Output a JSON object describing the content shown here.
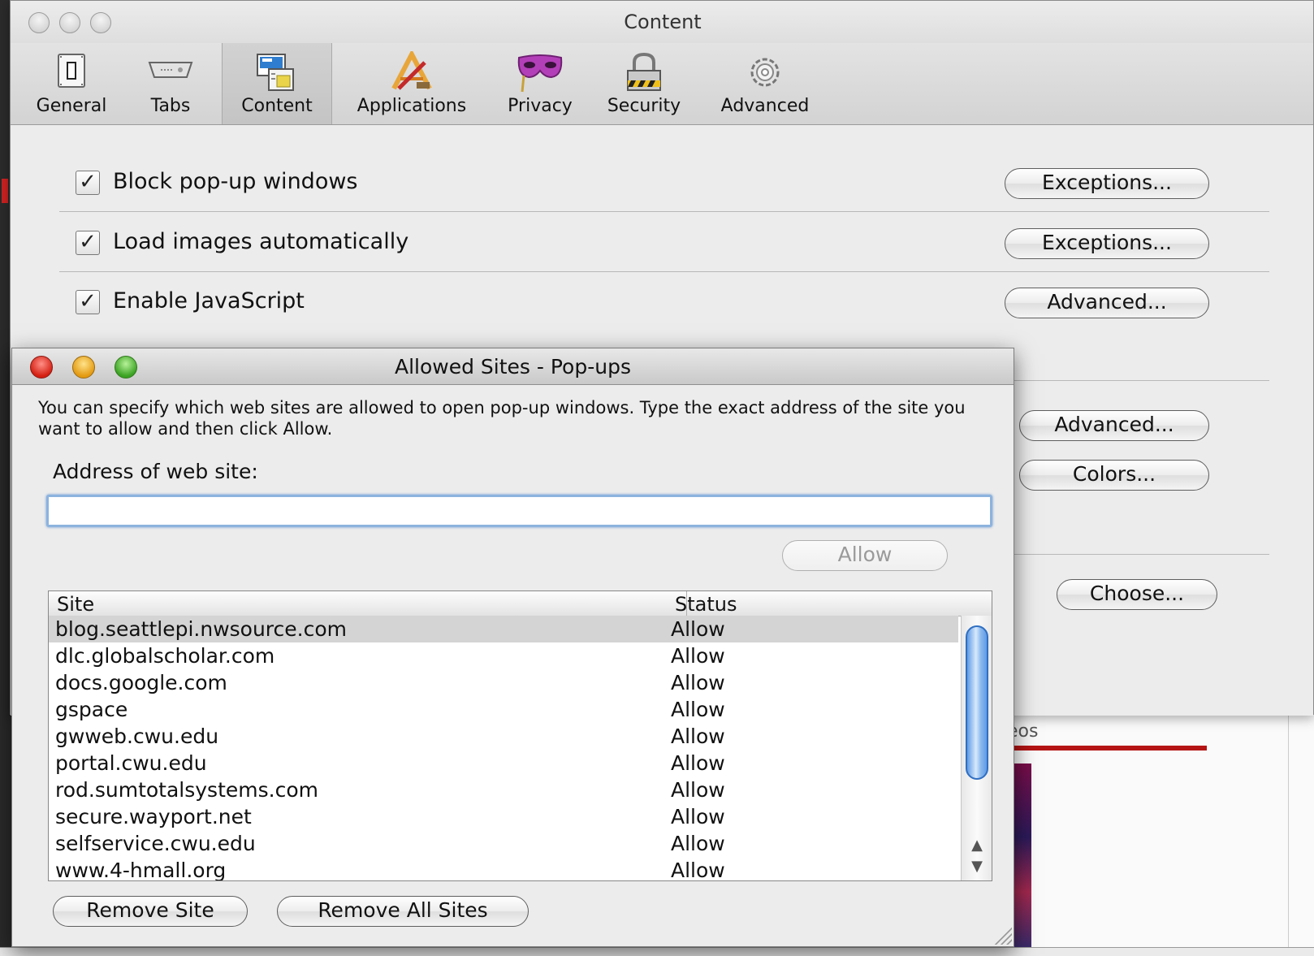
{
  "prefs": {
    "title": "Content",
    "toolbar": [
      {
        "label": "General",
        "icon": "general-switch-icon"
      },
      {
        "label": "Tabs",
        "icon": "tabs-icon"
      },
      {
        "label": "Content",
        "icon": "content-page-icon",
        "selected": true
      },
      {
        "label": "Applications",
        "icon": "applications-icon"
      },
      {
        "label": "Privacy",
        "icon": "privacy-mask-icon"
      },
      {
        "label": "Security",
        "icon": "security-lock-icon"
      },
      {
        "label": "Advanced",
        "icon": "advanced-gear-icon"
      }
    ],
    "rows": {
      "block_popups": {
        "label": "Block pop-up windows",
        "checked": true,
        "button": "Exceptions..."
      },
      "load_images": {
        "label": "Load images automatically",
        "checked": true,
        "button": "Exceptions..."
      },
      "enable_js": {
        "label": "Enable JavaScript",
        "checked": true,
        "button": "Advanced..."
      }
    },
    "advanced_button_2": "Advanced...",
    "colors_button": "Colors...",
    "choose_button": "Choose..."
  },
  "background": {
    "partial_text": "eos"
  },
  "dialog": {
    "title": "Allowed Sites - Pop-ups",
    "description": "You can specify which web sites are allowed to open pop-up windows. Type the exact address of the site you want to allow and then click Allow.",
    "address_label": "Address of web site:",
    "address_value": "",
    "allow_button": "Allow",
    "columns": {
      "site": "Site",
      "status": "Status"
    },
    "rows": [
      {
        "site": "blog.seattlepi.nwsource.com",
        "status": "Allow",
        "selected": true
      },
      {
        "site": "dlc.globalscholar.com",
        "status": "Allow"
      },
      {
        "site": "docs.google.com",
        "status": "Allow"
      },
      {
        "site": "gspace",
        "status": "Allow"
      },
      {
        "site": "gwweb.cwu.edu",
        "status": "Allow"
      },
      {
        "site": "portal.cwu.edu",
        "status": "Allow"
      },
      {
        "site": "rod.sumtotalsystems.com",
        "status": "Allow"
      },
      {
        "site": "secure.wayport.net",
        "status": "Allow"
      },
      {
        "site": "selfservice.cwu.edu",
        "status": "Allow"
      },
      {
        "site": "www.4-hmall.org",
        "status": "Allow"
      }
    ],
    "remove_site_button": "Remove Site",
    "remove_all_button": "Remove All Sites"
  }
}
